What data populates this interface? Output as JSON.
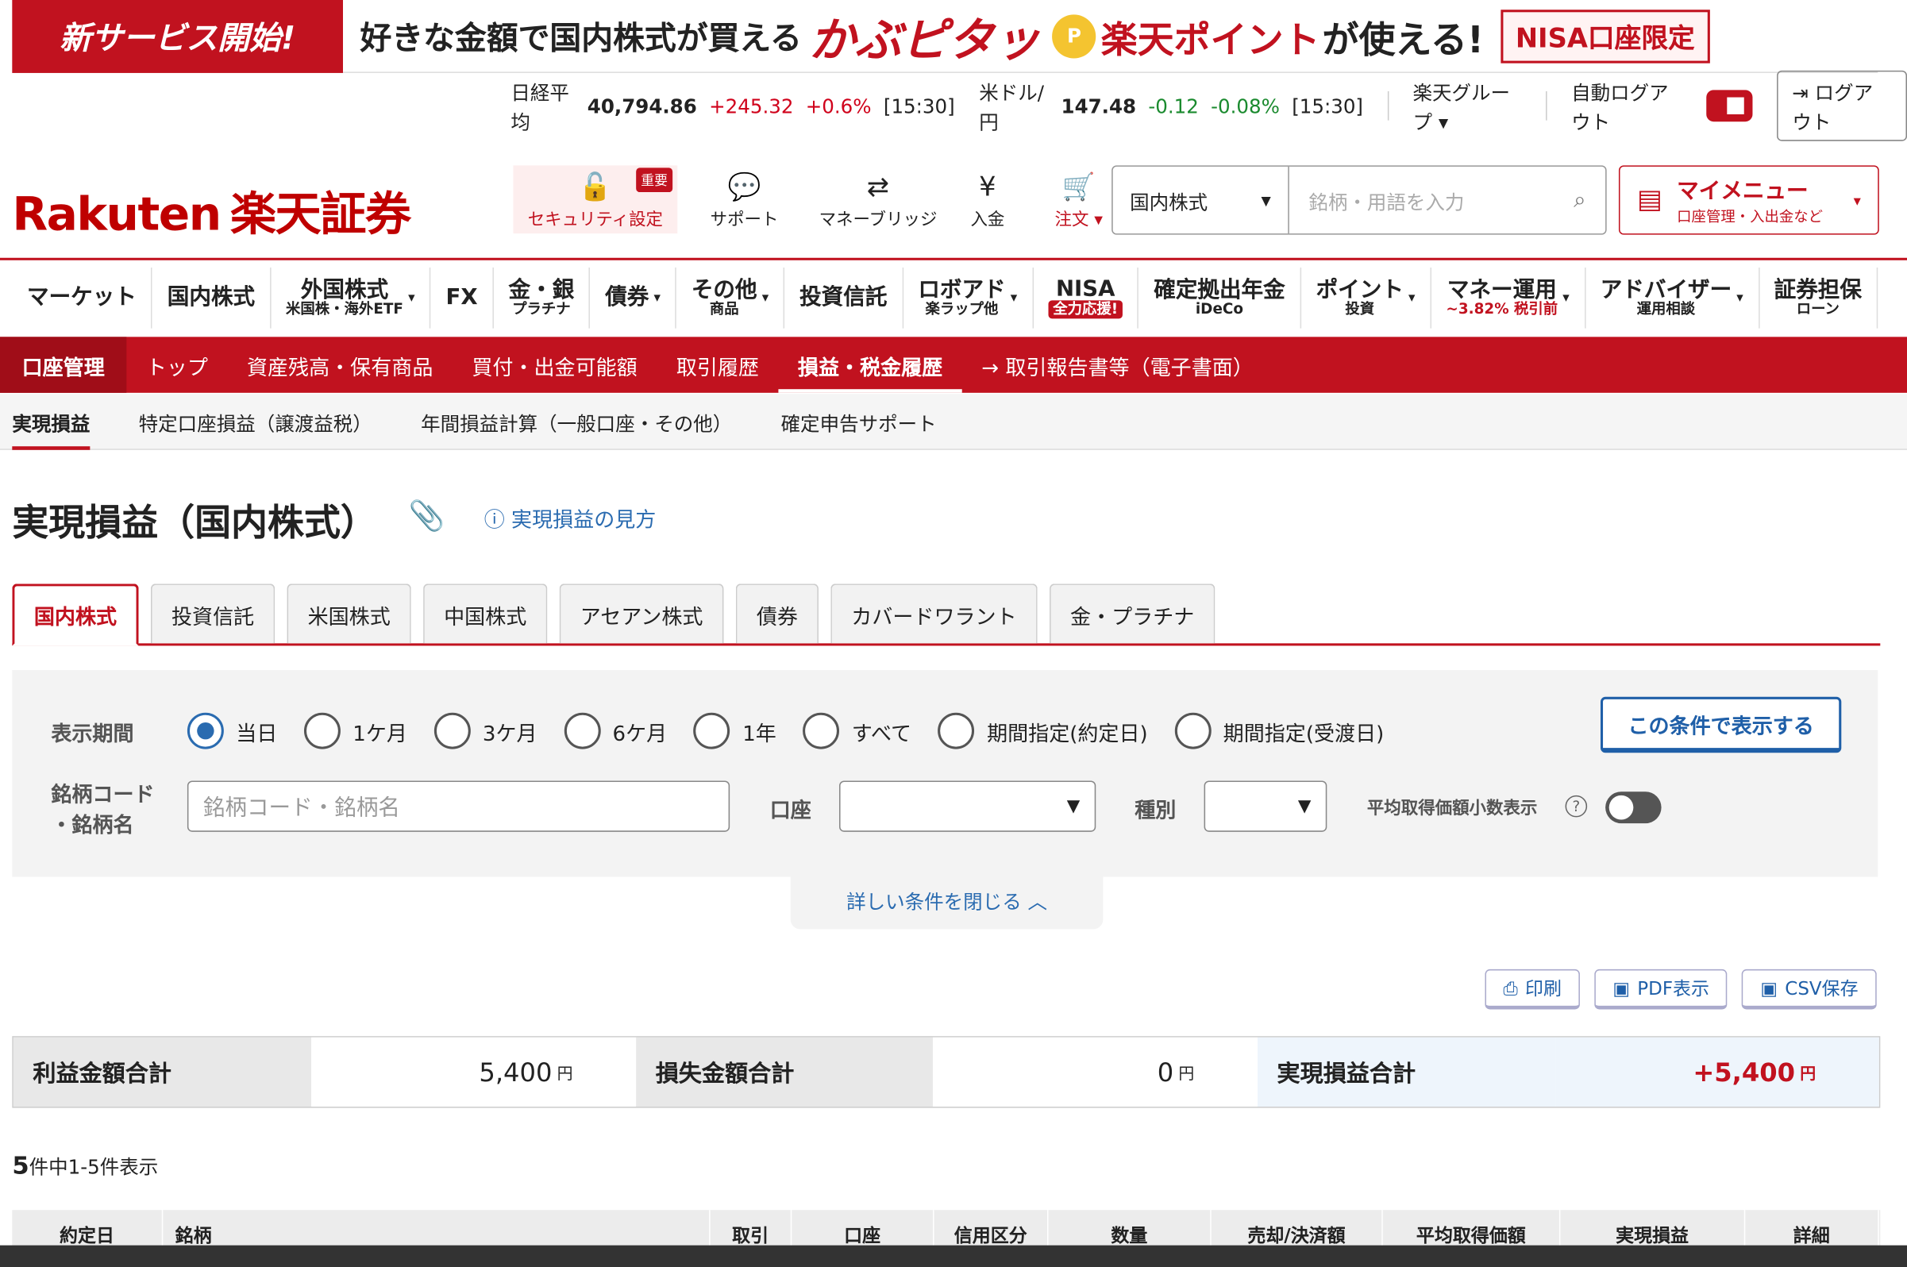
{
  "banner": {
    "badge": "新サービス開始!",
    "text1": "好きな金額で国内株式が買える",
    "brand": "かぶピタッ",
    "point_icon": "P",
    "text2": "楽天ポイント",
    "text3": "が使える!",
    "nisa": "NISA口座限定"
  },
  "ticker": {
    "nikkei_label": "日経平均",
    "nikkei_value": "40,794.86",
    "nikkei_change": "+245.32",
    "nikkei_pct": "+0.6%",
    "nikkei_time": "[15:30]",
    "usd_label": "米ドル/円",
    "usd_value": "147.48",
    "usd_change": "-0.12",
    "usd_pct": "-0.08%",
    "usd_time": "[15:30]",
    "group": "楽天グループ",
    "auto_logout": "自動ログアウト",
    "logout": "ログアウト"
  },
  "logo": {
    "rakuten": "Rakuten",
    "name": "楽天証券"
  },
  "header_icons": {
    "security": "セキュリティ設定",
    "security_badge": "重要",
    "support": "サポート",
    "bridge": "マネーブリッジ",
    "deposit": "入金",
    "order": "注文"
  },
  "search": {
    "category": "国内株式",
    "placeholder": "銘柄・用語を入力"
  },
  "mymenu": {
    "title": "マイメニュー",
    "sub": "口座管理・入出金など"
  },
  "gnav": [
    {
      "l1": "マーケット"
    },
    {
      "l1": "国内株式"
    },
    {
      "l1": "外国株式",
      "l2": "米国株・海外ETF"
    },
    {
      "l1": "FX"
    },
    {
      "l1": "金・銀",
      "l2": "プラチナ"
    },
    {
      "l1": "債券"
    },
    {
      "l1": "その他",
      "l2": "商品"
    },
    {
      "l1": "投資信託"
    },
    {
      "l1": "ロボアド",
      "l2": "楽ラップ他"
    },
    {
      "l1": "NISA",
      "l2": "全力応援!"
    },
    {
      "l1": "確定拠出年金",
      "l2": "iDeCo"
    },
    {
      "l1": "ポイント",
      "l2": "投資"
    },
    {
      "l1": "マネー運用",
      "l2": "~3.82% 税引前"
    },
    {
      "l1": "アドバイザー",
      "l2": "運用相談"
    },
    {
      "l1": "証券担保",
      "l2": "ローン"
    }
  ],
  "acctbar": {
    "header": "口座管理",
    "tabs": [
      "トップ",
      "資産残高・保有商品",
      "買付・出金可能額",
      "取引履歴",
      "損益・税金履歴",
      "→ 取引報告書等（電子書面）"
    ]
  },
  "subnav": [
    "実現損益",
    "特定口座損益（譲渡益税）",
    "年間損益計算（一般口座・その他）",
    "確定申告サポート"
  ],
  "page": {
    "title": "実現損益（国内株式）",
    "howto": "実現損益の見方"
  },
  "tabs": [
    "国内株式",
    "投資信託",
    "米国株式",
    "中国株式",
    "アセアン株式",
    "債券",
    "カバードワラント",
    "金・プラチナ"
  ],
  "filter": {
    "period_label": "表示期間",
    "periods": [
      "当日",
      "1ケ月",
      "3ケ月",
      "6ケ月",
      "1年",
      "すべて",
      "期間指定(約定日)",
      "期間指定(受渡日)"
    ],
    "apply": "この条件で表示する",
    "code_label1": "銘柄コード",
    "code_label2": "・銘柄名",
    "code_placeholder": "銘柄コード・銘柄名",
    "account_label": "口座",
    "type_label": "種別",
    "avg_label": "平均取得価額小数表示",
    "close": "詳しい条件を閉じる"
  },
  "actions": {
    "print": "印刷",
    "pdf": "PDF表示",
    "csv": "CSV保存"
  },
  "summary": {
    "profit_label": "利益金額合計",
    "profit": "5,400",
    "loss_label": "損失金額合計",
    "loss": "0",
    "total_label": "実現損益合計",
    "total": "+5,400",
    "unit": "円"
  },
  "count": {
    "num": "5",
    "text": "件中1-5件表示"
  },
  "table_headers": [
    "約定日",
    "銘柄",
    "取引",
    "口座",
    "信用区分",
    "数量",
    "売却/決済額",
    "平均取得価額",
    "実現損益",
    "詳細"
  ],
  "colors": {
    "brand_red": "#c1121f",
    "link_blue": "#2a6bb0"
  }
}
